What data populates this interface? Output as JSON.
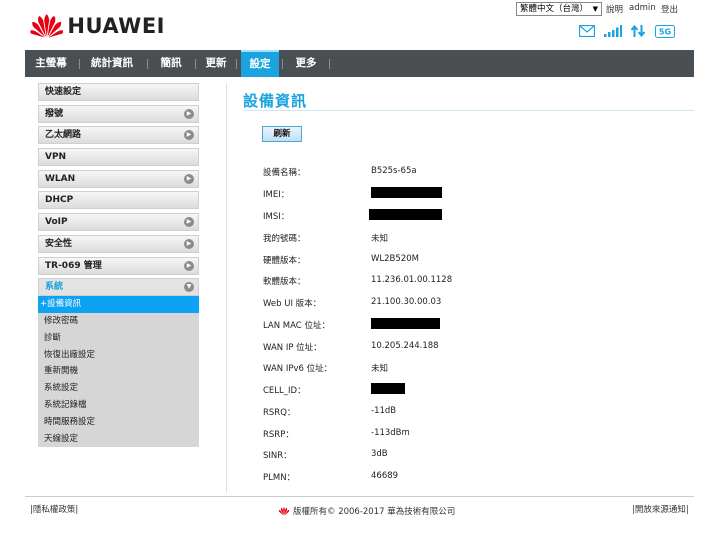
{
  "brand": {
    "name": "HUAWEI"
  },
  "topbar": {
    "language": "繁體中文（台灣）",
    "help": "說明",
    "user": "admin",
    "logout": "登出"
  },
  "status": {
    "network_badge": "5G"
  },
  "nav": {
    "items": [
      {
        "label": "主螢幕"
      },
      {
        "label": "統計資訊"
      },
      {
        "label": "簡訊"
      },
      {
        "label": "更新"
      },
      {
        "label": "設定"
      },
      {
        "label": "更多"
      }
    ],
    "active": "設定"
  },
  "sidebar": {
    "items": [
      {
        "label": "快速設定",
        "arrow": false
      },
      {
        "label": "撥號",
        "arrow": true
      },
      {
        "label": "乙太網路",
        "arrow": true
      },
      {
        "label": "VPN",
        "arrow": false
      },
      {
        "label": "WLAN",
        "arrow": true
      },
      {
        "label": "DHCP",
        "arrow": false
      },
      {
        "label": "VoIP",
        "arrow": true
      },
      {
        "label": "安全性",
        "arrow": true
      },
      {
        "label": "TR-069 管理",
        "arrow": true
      }
    ],
    "open_section": {
      "label": "系統",
      "children": [
        {
          "label": "+設備資訊",
          "active": true
        },
        {
          "label": "修改密碼"
        },
        {
          "label": "診斷"
        },
        {
          "label": "恢復出廠設定"
        },
        {
          "label": "重新開機"
        },
        {
          "label": "系統設定"
        },
        {
          "label": "系統記錄檔"
        },
        {
          "label": "時間服務設定"
        },
        {
          "label": "天線設定"
        }
      ]
    }
  },
  "main": {
    "title": "設備資訊",
    "refresh_label": "刷新",
    "rows": [
      {
        "label": "設備名稱：",
        "value": "B525s-65a"
      },
      {
        "label": "IMEI：",
        "value": ""
      },
      {
        "label": "IMSI：",
        "value": ""
      },
      {
        "label": "我的號碼：",
        "value": "未知"
      },
      {
        "label": "硬體版本：",
        "value": "WL2B520M"
      },
      {
        "label": "軟體版本：",
        "value": "11.236.01.00.1128"
      },
      {
        "label": "Web UI 版本：",
        "value": "21.100.30.00.03"
      },
      {
        "label": "LAN MAC 位址：",
        "value": ""
      },
      {
        "label": "WAN IP 位址：",
        "value": "10.205.244.188"
      },
      {
        "label": "WAN IPv6 位址：",
        "value": "未知"
      },
      {
        "label": "CELL_ID：",
        "value": ""
      },
      {
        "label": "RSRQ：",
        "value": "-11dB"
      },
      {
        "label": "RSRP：",
        "value": "-113dBm"
      },
      {
        "label": "SINR：",
        "value": "3dB"
      },
      {
        "label": "PLMN：",
        "value": "46689"
      }
    ]
  },
  "footer": {
    "privacy": "隱私權政策",
    "copyright": "版權所有© 2006-2017 華為技術有限公司",
    "opensource": "開放來源通知"
  },
  "colors": {
    "accent": "#1aa3de",
    "navbar": "#4a4f53",
    "brand_red": "#e60012"
  }
}
